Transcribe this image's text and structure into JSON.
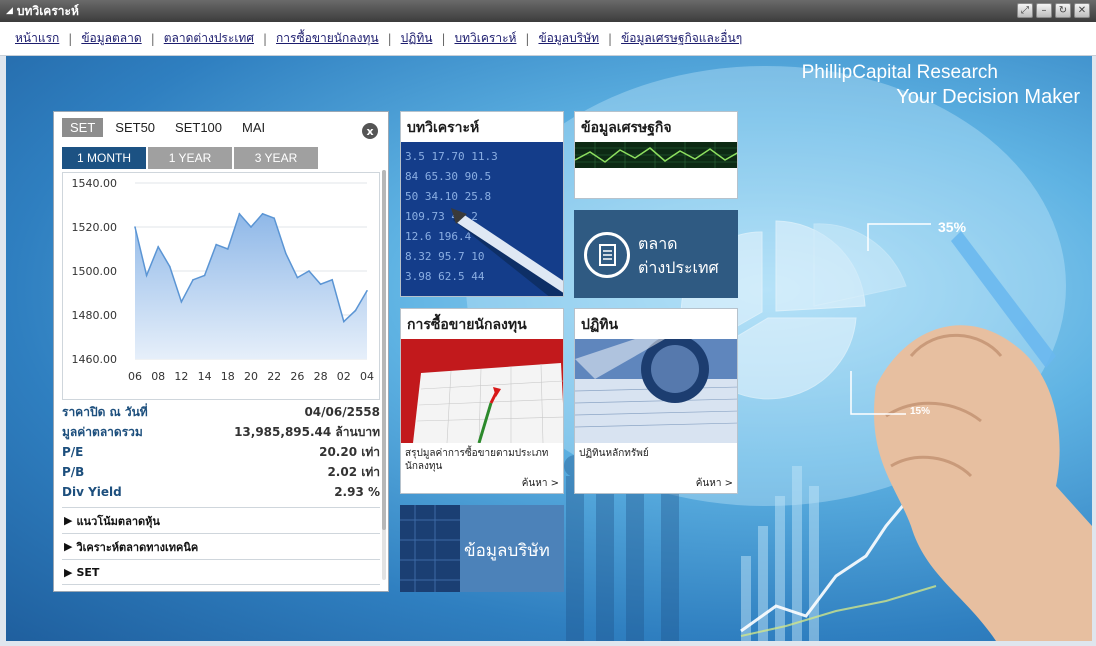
{
  "window": {
    "title": "บทวิเคราะห์"
  },
  "nav": [
    "หน้าแรก",
    "ข้อมูลตลาด",
    "ตลาดต่างประเทศ",
    "การซื้อขายนักลงทุน",
    "ปฏิทิน",
    "บทวิเคราะห์",
    "ข้อมูลบริษัท",
    "ข้อมูลเศรษฐกิจและอื่นๆ"
  ],
  "hero": {
    "brand_line1": "PhillipCapital Research",
    "brand_line2": "Your Decision Maker"
  },
  "panel": {
    "market_tabs": [
      "SET",
      "SET50",
      "SET100",
      "MAI"
    ],
    "active_market": "SET",
    "close_label": "x",
    "period_tabs": [
      "1 MONTH",
      "1 YEAR",
      "3 YEAR"
    ],
    "active_period": "1 MONTH",
    "stats": [
      {
        "label": "ราคาปิด ณ วันที่",
        "value": "04/06/2558"
      },
      {
        "label": "มูลค่าตลาดรวม",
        "value": "13,985,895.44 ล้านบาท"
      },
      {
        "label": "P/E",
        "value": "20.20 เท่า"
      },
      {
        "label": "P/B",
        "value": "2.02 เท่า"
      },
      {
        "label": "Div Yield",
        "value": "2.93 %"
      }
    ],
    "links": [
      "แนวโน้มตลาดหุ้น",
      "วิเคราะห์ตลาดทางเทคนิค",
      "SET"
    ]
  },
  "chart_data": {
    "type": "area",
    "title": "",
    "xlabel": "",
    "ylabel": "",
    "x_ticks": [
      "06",
      "08",
      "12",
      "14",
      "18",
      "20",
      "22",
      "26",
      "28",
      "02",
      "04"
    ],
    "y_ticks": [
      "1460.00",
      "1480.00",
      "1500.00",
      "1520.00",
      "1540.00"
    ],
    "ylim": [
      1460,
      1540
    ],
    "series": [
      {
        "values": [
          1520,
          1498,
          1511,
          1502,
          1486,
          1496,
          1498,
          1512,
          1510,
          1526,
          1520,
          1526,
          1524,
          1508,
          1497,
          1500,
          1494,
          1496,
          1477,
          1482,
          1491
        ]
      }
    ],
    "grid": true,
    "colors": {
      "line": "#5b95d4",
      "fill_top": "#8fb8e8",
      "fill_bottom": "#e6effa"
    }
  },
  "tiles": {
    "analysis": {
      "title": "บทวิเคราะห์"
    },
    "economy": {
      "title": "ข้อมูลเศรษฐกิจ"
    },
    "foreign": {
      "title_line1": "ตลาด",
      "title_line2": "ต่างประเทศ"
    },
    "investor": {
      "title": "การซื้อขายนักลงทุน",
      "desc": "สรุปมูลค่าการซื้อขายตามประเภทนักลงทุน",
      "more": "ค้นหา >"
    },
    "calendar": {
      "title": "ปฏิทิน",
      "desc": "ปฏิทินหลักทรัพย์",
      "more": "ค้นหา >"
    },
    "company": {
      "title": "ข้อมูลบริษัท"
    }
  },
  "decor": {
    "pie_pct1": "35%",
    "pie_pct2": "15%"
  }
}
